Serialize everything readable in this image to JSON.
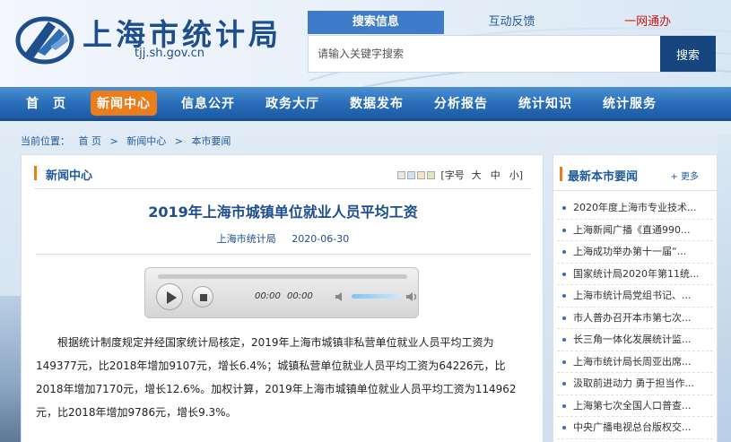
{
  "header": {
    "site_title": "上海市统计局",
    "domain": "tjj.sh.gov.cn",
    "search_tabs": [
      "搜索信息",
      "互动反馈",
      "一网通办"
    ],
    "search_placeholder": "请输入关键字搜索",
    "search_button": "搜索"
  },
  "nav": {
    "items": [
      "首　页",
      "新闻中心",
      "信息公开",
      "政务大厅",
      "数据发布",
      "分析报告",
      "统计知识",
      "统计服务"
    ]
  },
  "breadcrumb": {
    "label": "当前位置：",
    "items": [
      "首 页",
      "新闻中心",
      "本市要闻"
    ],
    "separator": ">"
  },
  "main": {
    "section_title": "新闻中心",
    "font_label": "[字号",
    "font_sizes": [
      "大",
      "中",
      "小]"
    ],
    "swatch_colors": [
      "#e8e8e8",
      "#cfe3f6",
      "#f0e6bf",
      "#d6e9c4"
    ],
    "article_title": "2019年上海市城镇单位就业人员平均工资",
    "source": "上海市统计局",
    "date": "2020-06-30",
    "player": {
      "current_time": "00:00",
      "total_time": "00:00"
    },
    "body": "根据统计制度规定并经国家统计局核定，2019年上海市城镇非私营单位就业人员平均工资为149377元，比2018年增加9107元，增长6.4%；城镇私营单位就业人员平均工资为64226元，比2018年增加7170元，增长12.6%。加权计算，2019年上海市城镇单位就业人员平均工资为114962元，比2018年增加9786元，增长9.3%。"
  },
  "sidebar": {
    "title": "最新本市要闻",
    "more": "+ 更多",
    "items": [
      "2020年度上海市专业技术...",
      "上海新闻广播《直通990...",
      "上海成功举办第十一届“...",
      "国家统计局2020年第11统...",
      "上海市统计局党组书记、...",
      "市人普办召开本市第七次...",
      "长三角一体化发展统计监...",
      "上海市统计局长周亚出席...",
      "汲取前进动力 勇于担当作...",
      "上海第七次全国人口普查...",
      "中央广播电视总台版权交..."
    ]
  },
  "colors": {
    "brand_blue": "#1f4e8c",
    "nav_blue": "#2b6fba",
    "accent_orange": "#ec7d1d",
    "red": "#d01414"
  }
}
